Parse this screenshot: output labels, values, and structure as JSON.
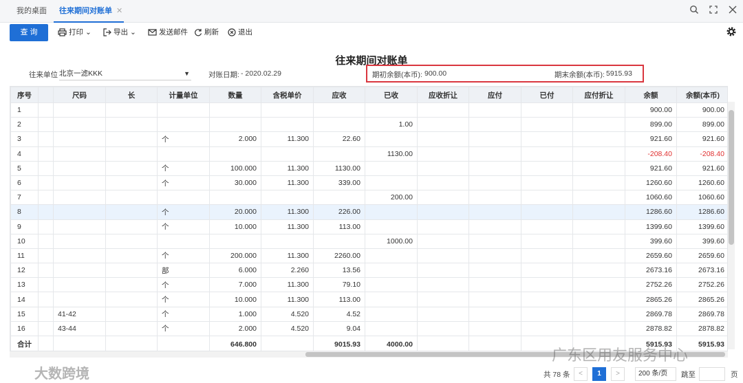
{
  "tabs": {
    "home": "我的桌面",
    "active": "往来期间对账单",
    "close": "✕"
  },
  "toolbar": {
    "query": "查 询",
    "print": "打印",
    "export": "导出",
    "email": "发送邮件",
    "refresh": "刷新",
    "exit": "退出"
  },
  "report": {
    "title": "往来期间对账单",
    "unit_label": "往来单位",
    "unit_value": "北京一滤KKK",
    "date_label": "对账日期:",
    "date_value": "- 2020.02.29",
    "opening_label": "期初余额(本币):",
    "opening_value": "900.00",
    "closing_label": "期末余额(本币):",
    "closing_value": "5915.93"
  },
  "table": {
    "headers": [
      "序号",
      "",
      "尺码",
      "长",
      "计量单位",
      "数量",
      "含税单价",
      "应收",
      "已收",
      "应收折让",
      "应付",
      "已付",
      "应付折让",
      "余额",
      "余额(本币)"
    ],
    "rows": [
      [
        "1",
        "",
        "",
        "",
        "",
        "",
        "",
        "",
        "",
        "",
        "",
        "",
        "",
        "900.00",
        "900.00"
      ],
      [
        "2",
        "",
        "",
        "",
        "",
        "",
        "",
        "",
        "1.00",
        "",
        "",
        "",
        "",
        "899.00",
        "899.00"
      ],
      [
        "3",
        "",
        "",
        "",
        "个",
        "2.000",
        "11.300",
        "22.60",
        "",
        "",
        "",
        "",
        "",
        "921.60",
        "921.60"
      ],
      [
        "4",
        "",
        "",
        "",
        "",
        "",
        "",
        "",
        "1130.00",
        "",
        "",
        "",
        "",
        "-208.40",
        "-208.40"
      ],
      [
        "5",
        "",
        "",
        "",
        "个",
        "100.000",
        "11.300",
        "1130.00",
        "",
        "",
        "",
        "",
        "",
        "921.60",
        "921.60"
      ],
      [
        "6",
        "",
        "",
        "",
        "个",
        "30.000",
        "11.300",
        "339.00",
        "",
        "",
        "",
        "",
        "",
        "1260.60",
        "1260.60"
      ],
      [
        "7",
        "",
        "",
        "",
        "",
        "",
        "",
        "",
        "200.00",
        "",
        "",
        "",
        "",
        "1060.60",
        "1060.60"
      ],
      [
        "8",
        "",
        "",
        "",
        "个",
        "20.000",
        "11.300",
        "226.00",
        "",
        "",
        "",
        "",
        "",
        "1286.60",
        "1286.60"
      ],
      [
        "9",
        "",
        "",
        "",
        "个",
        "10.000",
        "11.300",
        "113.00",
        "",
        "",
        "",
        "",
        "",
        "1399.60",
        "1399.60"
      ],
      [
        "10",
        "",
        "",
        "",
        "",
        "",
        "",
        "",
        "1000.00",
        "",
        "",
        "",
        "",
        "399.60",
        "399.60"
      ],
      [
        "11",
        "",
        "",
        "",
        "个",
        "200.000",
        "11.300",
        "2260.00",
        "",
        "",
        "",
        "",
        "",
        "2659.60",
        "2659.60"
      ],
      [
        "12",
        "",
        "",
        "",
        "部",
        "6.000",
        "2.260",
        "13.56",
        "",
        "",
        "",
        "",
        "",
        "2673.16",
        "2673.16"
      ],
      [
        "13",
        "",
        "",
        "",
        "个",
        "7.000",
        "11.300",
        "79.10",
        "",
        "",
        "",
        "",
        "",
        "2752.26",
        "2752.26"
      ],
      [
        "14",
        "",
        "",
        "",
        "个",
        "10.000",
        "11.300",
        "113.00",
        "",
        "",
        "",
        "",
        "",
        "2865.26",
        "2865.26"
      ],
      [
        "15",
        "",
        "41-42",
        "",
        "个",
        "1.000",
        "4.520",
        "4.52",
        "",
        "",
        "",
        "",
        "",
        "2869.78",
        "2869.78"
      ],
      [
        "16",
        "",
        "43-44",
        "",
        "个",
        "2.000",
        "4.520",
        "9.04",
        "",
        "",
        "",
        "",
        "",
        "2878.82",
        "2878.82"
      ]
    ],
    "total": [
      "合计",
      "",
      "",
      "",
      "",
      "646.800",
      "",
      "9015.93",
      "4000.00",
      "",
      "",
      "",
      "",
      "5915.93",
      "5915.93"
    ]
  },
  "pager": {
    "total_text": "共 78 条",
    "prev": "<",
    "current_page": "1",
    "next": ">",
    "page_size": "200 条/页",
    "jump_label": "跳至",
    "page_suffix": "页"
  },
  "watermarks": {
    "left": "大数跨境",
    "right": "广东区用友服务中心"
  }
}
